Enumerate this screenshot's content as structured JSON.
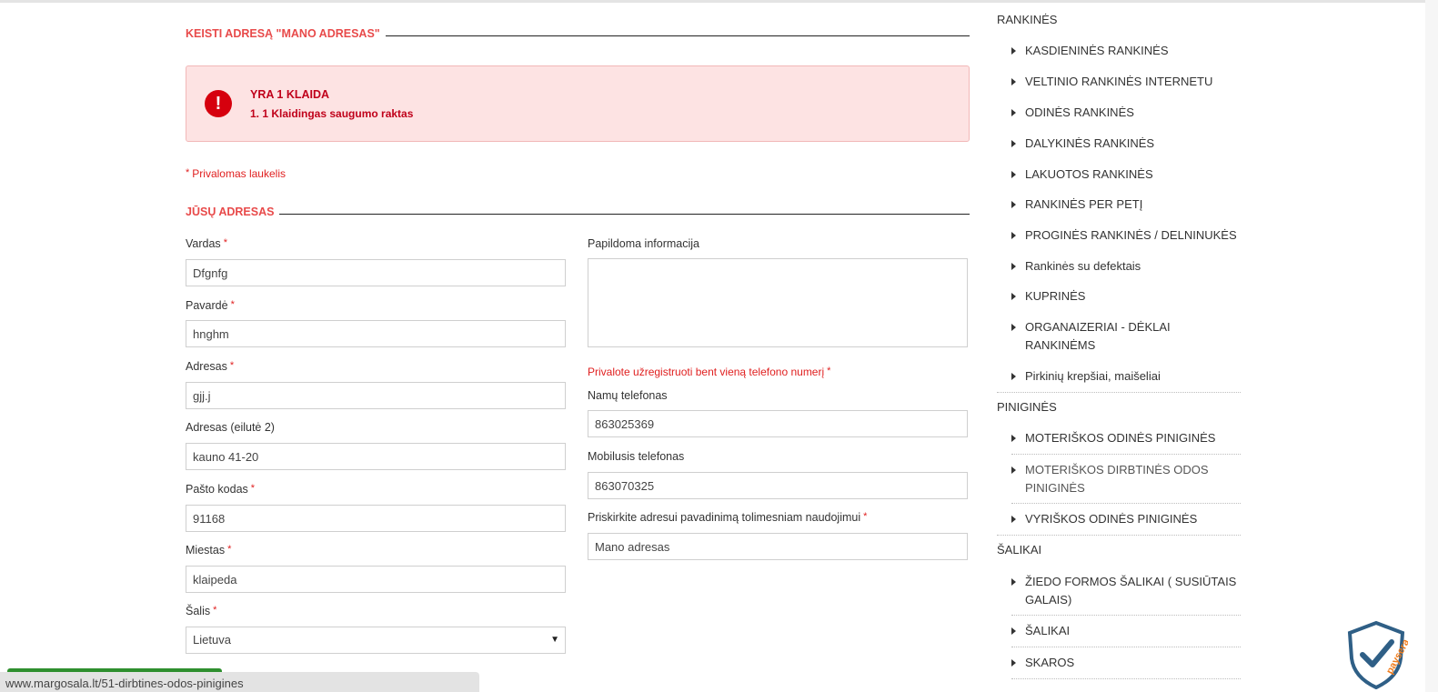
{
  "page": {
    "heading": "KEISTI ADRESĄ \"MANO ADRESAS\"",
    "alert": {
      "title": "YRA 1 KLAIDA",
      "message": "1. 1 Klaidingas saugumo raktas",
      "icon": "exclamation-icon"
    },
    "required_note": "Privalomas laukelis",
    "section_heading": "JŪSŲ ADRESAS",
    "required_marker": "*",
    "phone_note": "Privalote užregistruoti bent vieną telefono numerį"
  },
  "form": {
    "vardas": {
      "label": "Vardas",
      "value": "Dfgnfg"
    },
    "pavarde": {
      "label": "Pavardė",
      "value": "hnghm"
    },
    "adresas": {
      "label": "Adresas",
      "value": "gjj.j"
    },
    "adresas2": {
      "label": "Adresas (eilutė 2)",
      "value": "kauno 41-20"
    },
    "pasto_kodas": {
      "label": "Pašto kodas",
      "value": "91168"
    },
    "miestas": {
      "label": "Miestas",
      "value": "klaipeda"
    },
    "salis": {
      "label": "Šalis",
      "value": "Lietuva"
    },
    "papildoma": {
      "label": "Papildoma informacija",
      "value": ""
    },
    "namu_tel": {
      "label": "Namų telefonas",
      "value": "863025369"
    },
    "mob_tel": {
      "label": "Mobilusis telefonas",
      "value": "863070325"
    },
    "alias": {
      "label": "Priskirkite adresui pavadinimą tolimesniam naudojimui",
      "value": "Mano adresas"
    }
  },
  "sidebar": {
    "categories": [
      {
        "name": "RANKINĖS",
        "items": [
          "KASDIENINĖS RANKINĖS",
          "VELTINIO RANKINĖS INTERNETU",
          "ODINĖS RANKINĖS",
          "DALYKINĖS RANKINĖS",
          "LAKUOTOS RANKINĖS",
          "RANKINĖS PER PETĮ",
          "PROGINĖS RANKINĖS / DELNINUKĖS",
          "Rankinės su defektais",
          "KUPRINĖS",
          "ORGANAIZERIAI - DĖKLAI RANKINĖMS",
          "Pirkinių krepšiai, maišeliai"
        ]
      },
      {
        "name": "PINIGINĖS",
        "items": [
          "MOTERIŠKOS ODINĖS PINIGINĖS",
          "MOTERIŠKOS DIRBTINĖS ODOS PINIGINĖS",
          "VYRIŠKOS ODINĖS PINIGINĖS"
        ]
      },
      {
        "name": "ŠALIKAI",
        "items": [
          "ŽIEDO FORMOS ŠALIKAI ( SUSIŪTAIS GALAIS)",
          "ŠALIKAI",
          "SKAROS"
        ]
      }
    ]
  },
  "status_bar": {
    "url": "www.margosala.lt/51-dirbtines-odos-pinigines"
  },
  "badge": {
    "text": "paysera",
    "icon": "shield-check-icon"
  },
  "colors": {
    "accent": "#e84a4a",
    "error": "#d6000e",
    "alert_bg": "#fde3e3"
  }
}
